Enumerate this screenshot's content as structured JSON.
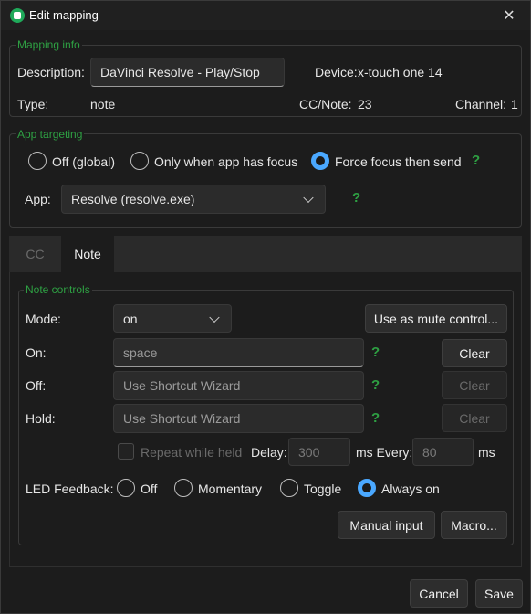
{
  "window": {
    "title": "Edit mapping",
    "close_icon": "close-icon"
  },
  "mapping_info": {
    "title": "Mapping info",
    "description_label": "Description:",
    "description_value": "DaVinci Resolve - Play/Stop",
    "device_label": "Device:",
    "device_value": "x-touch one 14",
    "type_label": "Type:",
    "type_value": "note",
    "ccnote_label": "CC/Note:",
    "ccnote_value": "23",
    "channel_label": "Channel:",
    "channel_value": "1"
  },
  "app_targeting": {
    "title": "App targeting",
    "options": [
      "Off (global)",
      "Only when app has focus",
      "Force focus then send"
    ],
    "selected_index": 2,
    "app_label": "App:",
    "app_value": "Resolve (resolve.exe)",
    "help": "?"
  },
  "tabs": {
    "items": [
      "CC",
      "Note"
    ],
    "active": "Note"
  },
  "note_controls": {
    "title": "Note controls",
    "mode_label": "Mode:",
    "mode_value": "on",
    "mute_button": "Use as mute control...",
    "on_label": "On:",
    "on_value": "space",
    "off_label": "Off:",
    "off_placeholder": "Use Shortcut Wizard",
    "hold_label": "Hold:",
    "hold_placeholder": "Use Shortcut Wizard",
    "clear_label": "Clear",
    "help": "?",
    "repeat_label": "Repeat while held",
    "delay_label": "Delay:",
    "delay_value": "300",
    "every_label": "ms Every:",
    "every_value": "80",
    "ms_label": "ms",
    "led_label": "LED Feedback:",
    "led_options": [
      "Off",
      "Momentary",
      "Toggle",
      "Always on"
    ],
    "led_selected_index": 3,
    "manual_input_button": "Manual input",
    "macro_button": "Macro..."
  },
  "footer": {
    "cancel": "Cancel",
    "save": "Save"
  },
  "colors": {
    "accent": "#4aa8ff",
    "group_title": "#2ea043",
    "background": "#1c1c1c"
  }
}
